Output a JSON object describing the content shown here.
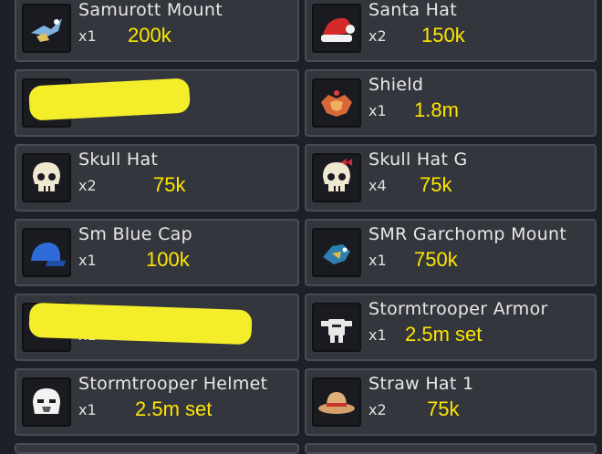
{
  "items": [
    {
      "name": "Samurott Mount",
      "qty": "x1",
      "price": "200k"
    },
    {
      "name": "Santa Hat",
      "qty": "x2",
      "price": "150k"
    },
    {
      "name": "",
      "qty": "",
      "price": ""
    },
    {
      "name": "Shield",
      "qty": "x1",
      "price": "1.8m"
    },
    {
      "name": "Skull Hat",
      "qty": "x2",
      "price": "75k"
    },
    {
      "name": "Skull Hat G",
      "qty": "x4",
      "price": "75k"
    },
    {
      "name": "Sm Blue Cap",
      "qty": "x1",
      "price": "100k"
    },
    {
      "name": "SMR Garchomp Mount",
      "qty": "x1",
      "price": "750k"
    },
    {
      "name": "",
      "qty": "x1",
      "price": ""
    },
    {
      "name": "Stormtrooper Armor",
      "qty": "x1",
      "price": "2.5m set"
    },
    {
      "name": "Stormtrooper Helmet",
      "qty": "x1",
      "price": "2.5m set"
    },
    {
      "name": "Straw Hat 1",
      "qty": "x2",
      "price": "75k"
    }
  ],
  "colors": {
    "background": "#1d2026",
    "card": "#34363d",
    "price": "#ffe600",
    "redaction": "#f4ee2a"
  }
}
